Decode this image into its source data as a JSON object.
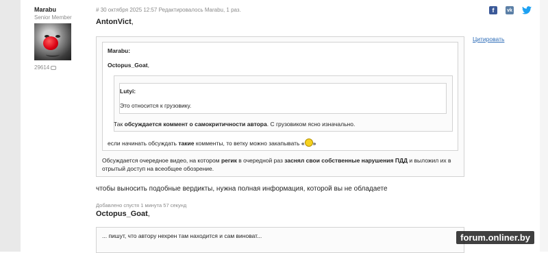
{
  "author": {
    "name": "Marabu",
    "rank": "Senior Member",
    "post_count": "29614"
  },
  "post": {
    "meta_hash": "#",
    "meta_date": "30 октября 2025 12:57",
    "meta_edited_prefix": "Редактировалось",
    "meta_edited_by": "Marabu",
    "meta_edited_suffix": ", 1 раз.",
    "quote_label": "Цитировать",
    "addressee1": "AntonVict",
    "q1_author": "Marabu:",
    "q1_addressee": "Octopus_Goat",
    "q2_author": "Lutyi:",
    "q2_text": "Это относится к грузовику.",
    "q1_line1_a": "Так ",
    "q1_line1_b": "обсуждается коммент о самокритичности автора",
    "q1_line1_c": ". С грузовиком ясно изначально.",
    "q1_line2_a": "если начинать обсуждать ",
    "q1_line2_b": "такие",
    "q1_line2_c": " комменты, то ветку можно закапывать",
    "outer_line1_a": "Обсуждается очередное видео, на котором ",
    "outer_line1_b": "регик",
    "outer_line1_c": " в очередной раз ",
    "outer_line1_d": "заснял свои собственные нарушения ПДД",
    "outer_line1_e": " и выложил их в",
    "outer_line2": "отрытый доступ на всеобщее обозрение.",
    "main_text": "чтобы выносить подобные вердикты, нужна полная информация, которой вы не обладаете",
    "added_label": "Добавлено спустя 1 минута 57 секунд",
    "addressee2": "Octopus_Goat",
    "quote3_text": "... пишут, что автору нехрен там находится и сам виноват..."
  },
  "share": {
    "fb_icon": "facebook-icon",
    "vk_icon": "vk-icon",
    "tw_icon": "twitter-icon"
  },
  "watermark": "forum.onliner.by"
}
